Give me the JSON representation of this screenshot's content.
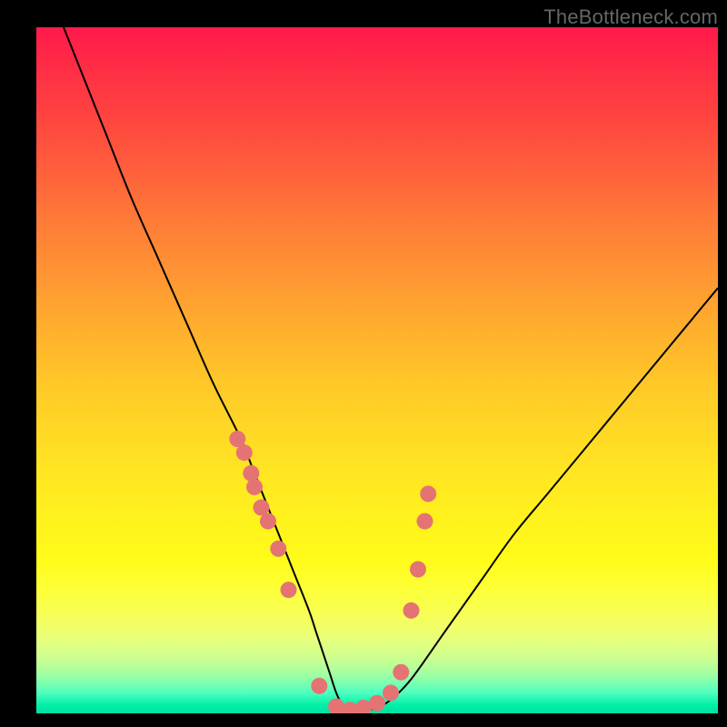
{
  "watermark": "TheBottleneck.com",
  "chart_data": {
    "type": "line",
    "title": "",
    "xlabel": "",
    "ylabel": "",
    "xlim": [
      0,
      100
    ],
    "ylim": [
      0,
      100
    ],
    "grid": false,
    "legend": false,
    "series": [
      {
        "name": "curve",
        "x": [
          4,
          6,
          8,
          10,
          14,
          18,
          22,
          26,
          30,
          32,
          34,
          36,
          38,
          40,
          41,
          42,
          43,
          44,
          45,
          46,
          48,
          50,
          52,
          55,
          60,
          65,
          70,
          75,
          80,
          85,
          90,
          95,
          100
        ],
        "y": [
          100,
          95,
          90,
          85,
          75,
          66,
          57,
          48,
          40,
          35,
          30,
          25,
          20,
          15,
          12,
          9,
          6,
          3,
          1,
          0.5,
          0.5,
          0.8,
          2,
          5,
          12,
          19,
          26,
          32,
          38,
          44,
          50,
          56,
          62
        ]
      }
    ],
    "markers": [
      {
        "name": "dots",
        "x": [
          29.5,
          30.5,
          31.5,
          32.0,
          33.0,
          34.0,
          35.5,
          37.0,
          41.5,
          44.0,
          46.0,
          48.0,
          50.0,
          52.0,
          53.5,
          55.0,
          56.0,
          57.0,
          57.5
        ],
        "y": [
          40,
          38,
          35,
          33,
          30,
          28,
          24,
          18,
          4,
          1,
          0.5,
          0.8,
          1.5,
          3,
          6,
          15,
          21,
          28,
          32
        ]
      }
    ],
    "background": {
      "type": "vertical-gradient",
      "stops": [
        {
          "pos": 0,
          "color": "#ff1a4b"
        },
        {
          "pos": 65,
          "color": "#ffe622"
        },
        {
          "pos": 100,
          "color": "#00e0a0"
        }
      ]
    }
  }
}
